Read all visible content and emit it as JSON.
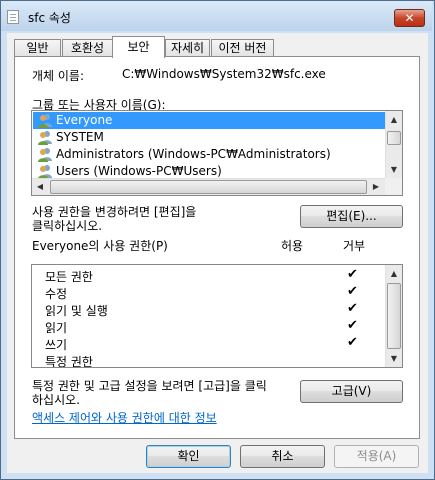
{
  "window": {
    "title": "sfc 속성",
    "close_glyph": "✕"
  },
  "tabs": [
    {
      "label": "일반",
      "active": false
    },
    {
      "label": "호환성",
      "active": false
    },
    {
      "label": "보안",
      "active": true
    },
    {
      "label": "자세히",
      "active": false
    },
    {
      "label": "이전 버전",
      "active": false
    }
  ],
  "object_name": {
    "label": "개체 이름:",
    "value": "C:₩Windows₩System32₩sfc.exe"
  },
  "groups": {
    "label": "그룹 또는 사용자 이름(G):",
    "items": [
      {
        "name": "Everyone",
        "icon": "user-group-icon",
        "selected": true
      },
      {
        "name": "SYSTEM",
        "icon": "user-group-icon",
        "selected": false
      },
      {
        "name": "Administrators (Windows-PC₩Administrators)",
        "icon": "user-group-icon",
        "selected": false
      },
      {
        "name": "Users (Windows-PC₩Users)",
        "icon": "user-group-icon",
        "selected": false
      }
    ]
  },
  "edit": {
    "text_line1": "사용 권한을 변경하려면 [편집]을",
    "text_line2": "클릭하십시오.",
    "button": "편집(E)..."
  },
  "permissions": {
    "label": "Everyone의 사용 권한(P)",
    "allow_header": "허용",
    "deny_header": "거부",
    "check_glyph": "✔",
    "items": [
      {
        "name": "모든 권한",
        "allow": false,
        "deny": true
      },
      {
        "name": "수정",
        "allow": false,
        "deny": true
      },
      {
        "name": "읽기 및 실행",
        "allow": false,
        "deny": true
      },
      {
        "name": "읽기",
        "allow": false,
        "deny": true
      },
      {
        "name": "쓰기",
        "allow": false,
        "deny": true
      },
      {
        "name": "특정 권한",
        "allow": false,
        "deny": false
      }
    ]
  },
  "advanced": {
    "text_line1": "특정 권한 및 고급 설정을 보려면 [고급]을 클릭",
    "text_line2": "하십시오.",
    "button": "고급(V)"
  },
  "help_link": "액세스 제어와 사용 권한에 대한 정보",
  "footer": {
    "ok": "확인",
    "cancel": "취소",
    "apply": "적용(A)"
  },
  "colors": {
    "selection": "#3399ff",
    "link": "#0066cc",
    "close_button": "#c7462a"
  }
}
